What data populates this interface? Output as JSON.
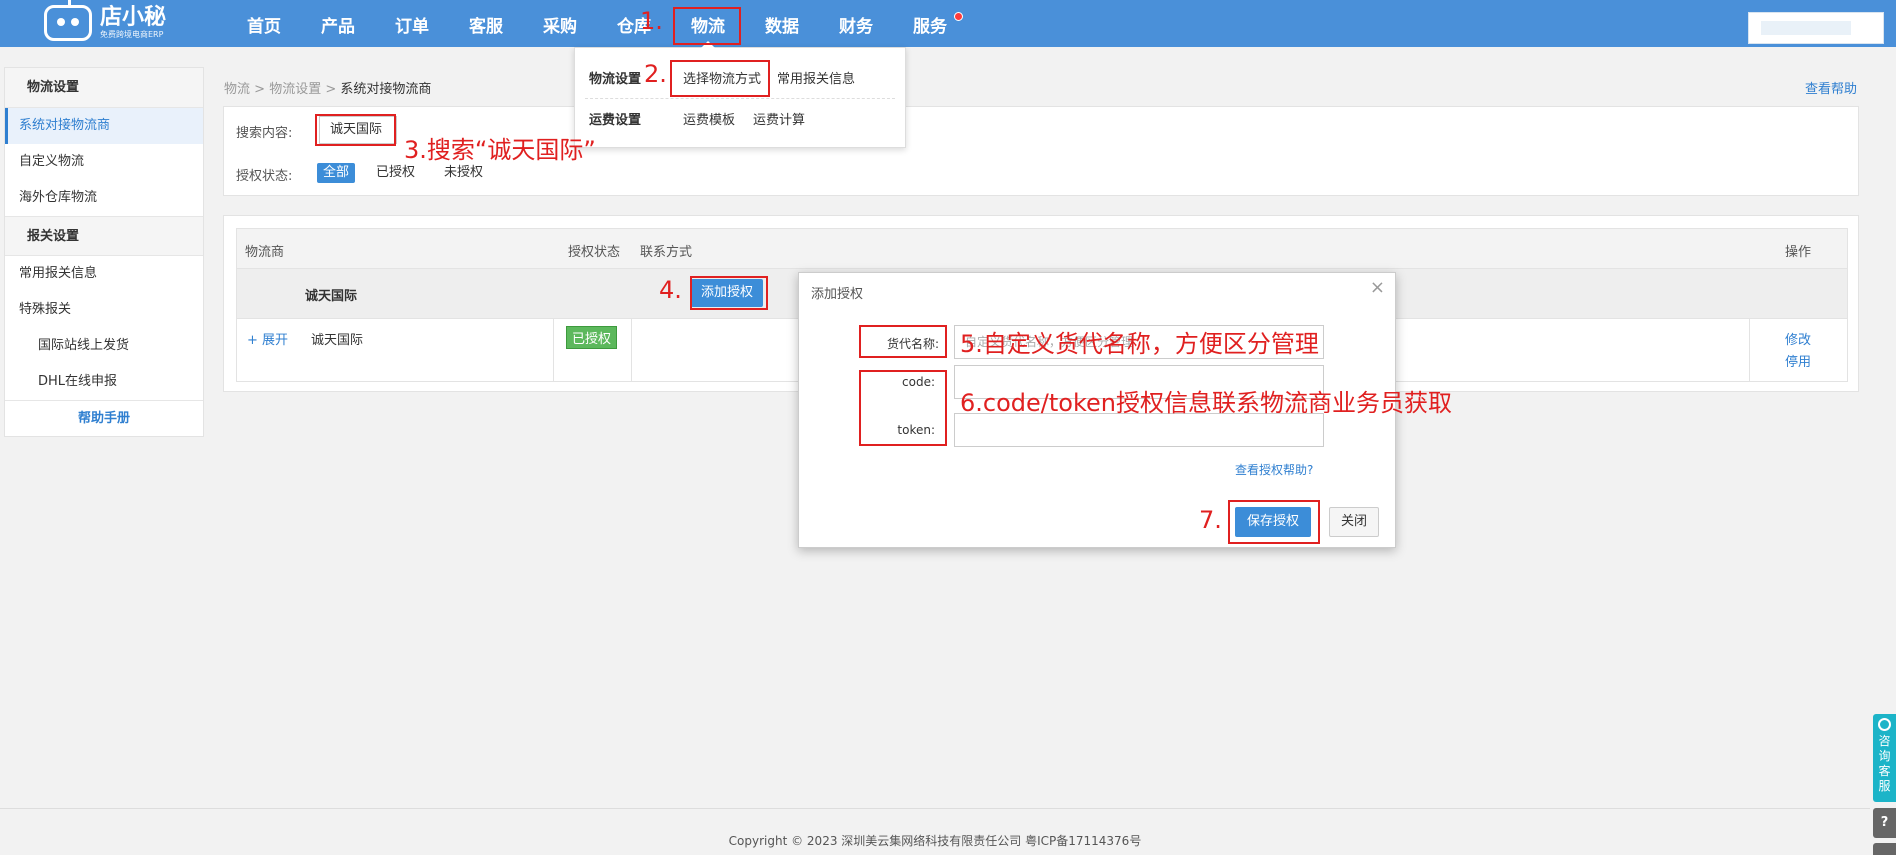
{
  "nav": {
    "logo_title": "店小秘",
    "logo_sub": "免费跨境电商ERP",
    "items": [
      "首页",
      "产品",
      "订单",
      "客服",
      "采购",
      "仓库",
      "物流",
      "数据",
      "财务",
      "服务"
    ]
  },
  "sidebar": {
    "section1": "物流设置",
    "items1": [
      "系统对接物流商",
      "自定义物流",
      "海外仓库物流"
    ],
    "section2": "报关设置",
    "items2": [
      "常用报关信息",
      "特殊报关"
    ],
    "subitems2": [
      "国际站线上发货",
      "DHL在线申报"
    ],
    "help": "帮助手册"
  },
  "breadcrumb": {
    "a": "物流",
    "sep": ">",
    "b": "物流设置",
    "c": "系统对接物流商"
  },
  "help_link": "查看帮助",
  "search": {
    "label": "搜索内容:",
    "value": "诚天国际",
    "status_label": "授权状态:",
    "status_options": [
      "全部",
      "已授权",
      "未授权"
    ]
  },
  "dropdown": {
    "group1": "物流设置",
    "group1_items": [
      "选择物流方式",
      "常用报关信息"
    ],
    "group2": "运费设置",
    "group2_items": [
      "运费模板",
      "运费计算"
    ]
  },
  "table": {
    "headers": [
      "物流商",
      "授权状态",
      "联系方式",
      "操作"
    ],
    "group_name": "诚天国际",
    "add_button": "添加授权",
    "row": {
      "expand": "+ 展开",
      "name": "诚天国际",
      "status": "已授权",
      "actions": [
        "修改",
        "停用"
      ]
    }
  },
  "modal": {
    "title": "添加授权",
    "close": "×",
    "name_label": "货代名称:",
    "name_placeholder": "自定义货代名称，方便区分管理",
    "code_label": "code:",
    "token_label": "token:",
    "help": "查看授权帮助?",
    "save": "保存授权",
    "cancel": "关闭"
  },
  "annotations": {
    "a1": "1.",
    "a2": "2.",
    "a3": "3.搜索“诚天国际”",
    "a4": "4.",
    "a5": "5.自定义货代名称，方便区分管理",
    "a6": "6.code/token授权信息联系物流商业务员获取",
    "a7": "7."
  },
  "float": {
    "consult": "咨询客服",
    "help": "?"
  },
  "footer": "Copyright © 2023 深圳美云集网络科技有限责任公司  粤ICP备17114376号",
  "colors": {
    "nav": "#4a90d9",
    "primary": "#3c8dd8",
    "annotation": "#e02020",
    "success": "#5cb85c"
  }
}
